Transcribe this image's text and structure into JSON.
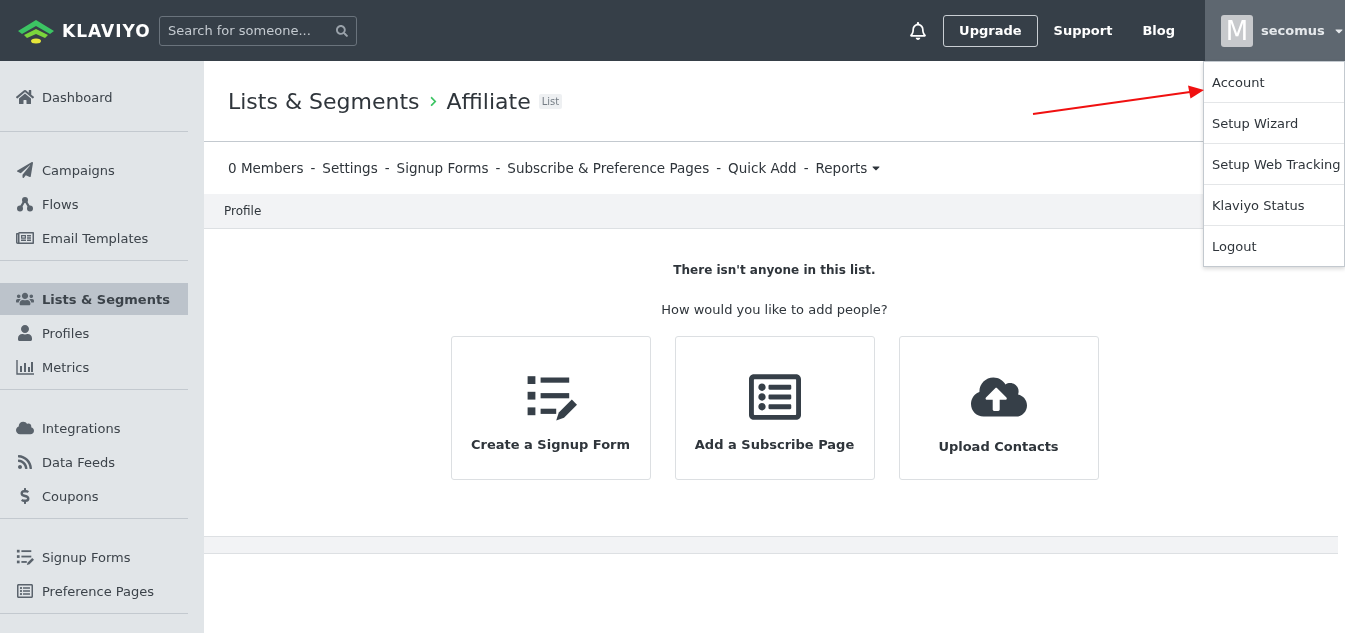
{
  "header": {
    "logo": "KLAVIYO",
    "search": {
      "placeholder": "Search for someone..."
    },
    "upgrade": "Upgrade",
    "links": [
      "Support",
      "Blog"
    ],
    "user": {
      "initial": "M",
      "name": "secomus",
      "menu_open": true
    }
  },
  "user_menu": [
    {
      "label": "Account"
    },
    {
      "label": "Setup Wizard"
    },
    {
      "label": "Setup Web Tracking"
    },
    {
      "label": "Klaviyo Status"
    },
    {
      "label": "Logout"
    }
  ],
  "sidebar": {
    "groups": [
      {
        "items": [
          {
            "label": "Dashboard",
            "selected": false
          }
        ]
      },
      {
        "items": [
          {
            "label": "Campaigns",
            "selected": false
          },
          {
            "label": "Flows",
            "selected": false
          },
          {
            "label": "Email Templates",
            "selected": false
          }
        ]
      },
      {
        "items": [
          {
            "label": "Lists & Segments",
            "selected": true
          },
          {
            "label": "Profiles",
            "selected": false
          },
          {
            "label": "Metrics",
            "selected": false
          }
        ]
      },
      {
        "items": [
          {
            "label": "Integrations",
            "selected": false
          },
          {
            "label": "Data Feeds",
            "selected": false
          },
          {
            "label": "Coupons",
            "selected": false
          }
        ]
      },
      {
        "items": [
          {
            "label": "Signup Forms",
            "selected": false
          },
          {
            "label": "Preference Pages",
            "selected": false
          }
        ]
      }
    ]
  },
  "page": {
    "breadcrumb": "Lists & Segments",
    "title": "Affiliate",
    "badge": "List",
    "nav": [
      {
        "kind": "link",
        "label": "0 Members"
      },
      {
        "kind": "separator",
        "label": "-"
      },
      {
        "kind": "link",
        "label": "Settings"
      },
      {
        "kind": "separator",
        "label": "-"
      },
      {
        "kind": "link",
        "label": "Signup Forms"
      },
      {
        "kind": "separator",
        "label": "-"
      },
      {
        "kind": "link",
        "label": "Subscribe & Preference Pages"
      },
      {
        "kind": "separator",
        "label": "-"
      },
      {
        "kind": "link",
        "label": "Quick Add"
      },
      {
        "kind": "separator",
        "label": "-"
      },
      {
        "kind": "dropdown",
        "label": "Reports"
      }
    ],
    "table_header": "Profile",
    "empty_title": "There isn't anyone in this list.",
    "question": "How would you like to add people?",
    "options": [
      {
        "label": "Create a Signup Form"
      },
      {
        "label": "Add a Subscribe Page"
      },
      {
        "label": "Upload Contacts"
      }
    ]
  },
  "annotation": {
    "kind": "arrow"
  }
}
